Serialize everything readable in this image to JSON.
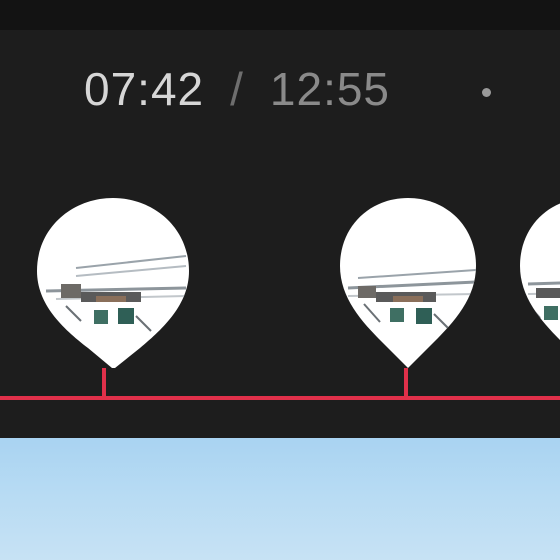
{
  "timeline": {
    "current_time": "07:42",
    "separator": "/",
    "total_time": "12:55"
  },
  "markers": [
    {
      "icon": "waypoint-thumbnail-icon",
      "thumbnail": "drone-on-rooftop"
    },
    {
      "icon": "waypoint-thumbnail-icon",
      "thumbnail": "drone-on-rooftop"
    },
    {
      "icon": "waypoint-thumbnail-icon",
      "thumbnail": "drone-on-rooftop"
    }
  ],
  "colors": {
    "accent": "#e0304a",
    "panel_bg": "#1d1d1d",
    "preview_sky": "#b7dbf3"
  }
}
